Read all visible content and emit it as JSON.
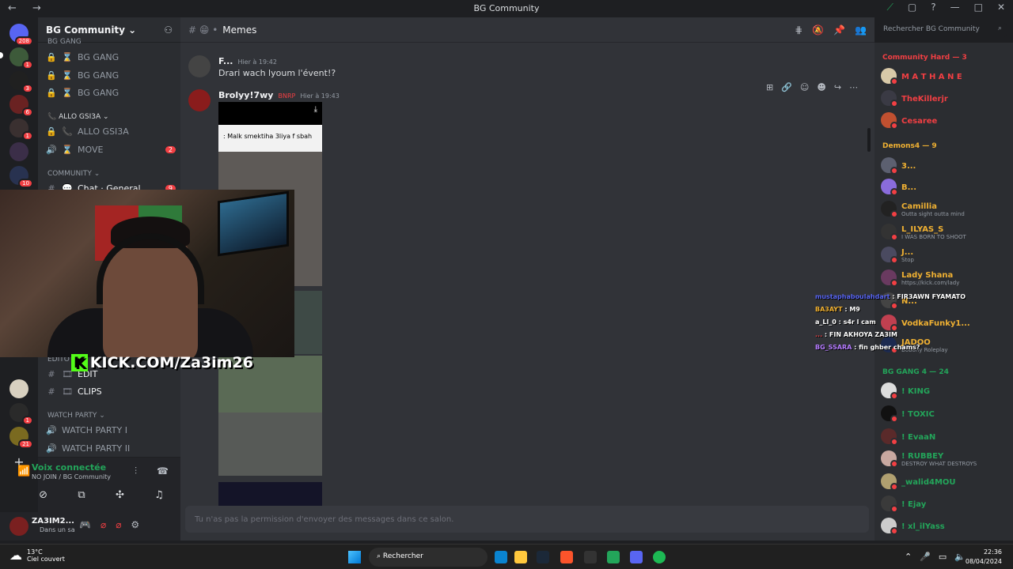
{
  "window": {
    "title": "BG Community",
    "nav": "← →",
    "controls": [
      "⟋",
      "▢",
      "?",
      "—",
      "□",
      "✕"
    ]
  },
  "guilds": {
    "home_badge": "208",
    "badges": [
      "1",
      "3",
      "6",
      "1",
      "",
      "10",
      "",
      "",
      "",
      "1",
      "21"
    ]
  },
  "server": {
    "name": "BG Community ⌄",
    "add_icon": "👤+"
  },
  "channels": {
    "top_cat": "BG GANG",
    "items": [
      {
        "label": "BG GANG",
        "icon": "🔒"
      },
      {
        "label": "BG GANG",
        "icon": "🔒"
      },
      {
        "label": "BG GANG",
        "icon": "🔒"
      }
    ],
    "allo_cat": "ALLO GSI3A ⌄",
    "allo": "ALLO GSI3A",
    "move": "MOVE",
    "move_badge": "2",
    "community_cat": "COMMUNITY ⌄",
    "chat_general": "Chat · General",
    "chat_badge": "9",
    "editor_cat": "EDITO",
    "edit": "EDIT",
    "clips": "CLIPS",
    "watch_cat": "WATCH PARTY ⌄",
    "watch1": "WATCH PARTY I",
    "watch2": "WATCH PARTY II"
  },
  "voice": {
    "status": "Voix connectée",
    "channel": "NO JOIN / BG Community"
  },
  "user": {
    "name": "ZA3IM2...",
    "status": "Dans un sa"
  },
  "webcam": {
    "overlay": "KICK.COM/Za3im26",
    "k": "K"
  },
  "chat": {
    "channel": "Memes",
    "header_prefix": "# 😁 •",
    "messages": [
      {
        "author": "F...",
        "time": "Hier à 19:42",
        "text": "Drari wach lyoum l'évent!?"
      },
      {
        "author": "Brolyy!7wy",
        "tag": "BNRP",
        "time": "Hier à 19:43",
        "caption": ": Malk smektiha 3liya f sbah"
      }
    ],
    "composer_placeholder": "Tu n'as pas la permission d'envoyer des messages dans ce salon."
  },
  "search": {
    "placeholder": "Rechercher BG Community"
  },
  "members": {
    "groups": [
      {
        "label": "Community Hard — 3",
        "color": "#f23f43"
      },
      {
        "label": "Demons4 — 9",
        "color": "#f0b132"
      },
      {
        "label": "BG GANG 4 — 24",
        "color": "#23a55a"
      }
    ],
    "list": [
      {
        "name": "M A T H A N E",
        "color": "#f23f43",
        "sub": ""
      },
      {
        "name": "TheKillerjr",
        "color": "#f23f43",
        "sub": ""
      },
      {
        "name": "Cesaree",
        "color": "#f23f43",
        "sub": ""
      },
      {
        "name": "3...",
        "color": "#f0b132",
        "sub": ""
      },
      {
        "name": "B...",
        "color": "#f0b132",
        "sub": ""
      },
      {
        "name": "Camillia",
        "color": "#f0b132",
        "sub": "Outta sight outta mind"
      },
      {
        "name": "L_ILYAS_S",
        "color": "#f0b132",
        "sub": "I WAS BORN TO SHOOT"
      },
      {
        "name": "J...",
        "color": "#f0b132",
        "sub": "Stop"
      },
      {
        "name": "Lady Shana",
        "color": "#f0b132",
        "sub": "https://kick.com/lady"
      },
      {
        "name": "N...",
        "color": "#f0b132",
        "sub": ""
      },
      {
        "name": "VodkaFunky1...",
        "color": "#f0b132",
        "sub": ""
      },
      {
        "name": "JADOO",
        "color": "#f0b132",
        "sub": "Bobony Roleplay"
      },
      {
        "name": "! KING",
        "color": "#23a55a",
        "sub": ""
      },
      {
        "name": "! TOXIC",
        "color": "#23a55a",
        "sub": ""
      },
      {
        "name": "! EvaaN",
        "color": "#23a55a",
        "sub": ""
      },
      {
        "name": "! RUBBEY",
        "color": "#23a55a",
        "sub": "DESTROY WHAT DESTROYS"
      },
      {
        "name": "_walid4MOU",
        "color": "#23a55a",
        "sub": ""
      },
      {
        "name": "! Ejay",
        "color": "#23a55a",
        "sub": ""
      },
      {
        "name": "! xl_ilYass",
        "color": "#23a55a",
        "sub": ""
      }
    ]
  },
  "overlay_chat": [
    {
      "user": "mustaphaboulahdart",
      "color": "#5865f2",
      "text": ": FIR3AWN FYAMATO"
    },
    {
      "user": "BA3AYT",
      "color": "#f0b132",
      "text": ": M9"
    },
    {
      "user": "a_Ll_0",
      "color": "#ffffff",
      "text": ": s4r l cam"
    },
    {
      "user": "...",
      "color": "#f23f43",
      "text": ": FIN AKHOYA ZA3IM"
    },
    {
      "user": "BG_SSARA",
      "color": "#b57cff",
      "text": ": fin ghber chams?"
    }
  ],
  "taskbar": {
    "temp": "13°C",
    "weather": "Ciel couvert",
    "search": "Rechercher",
    "time": "22:36",
    "date": "08/04/2024"
  }
}
